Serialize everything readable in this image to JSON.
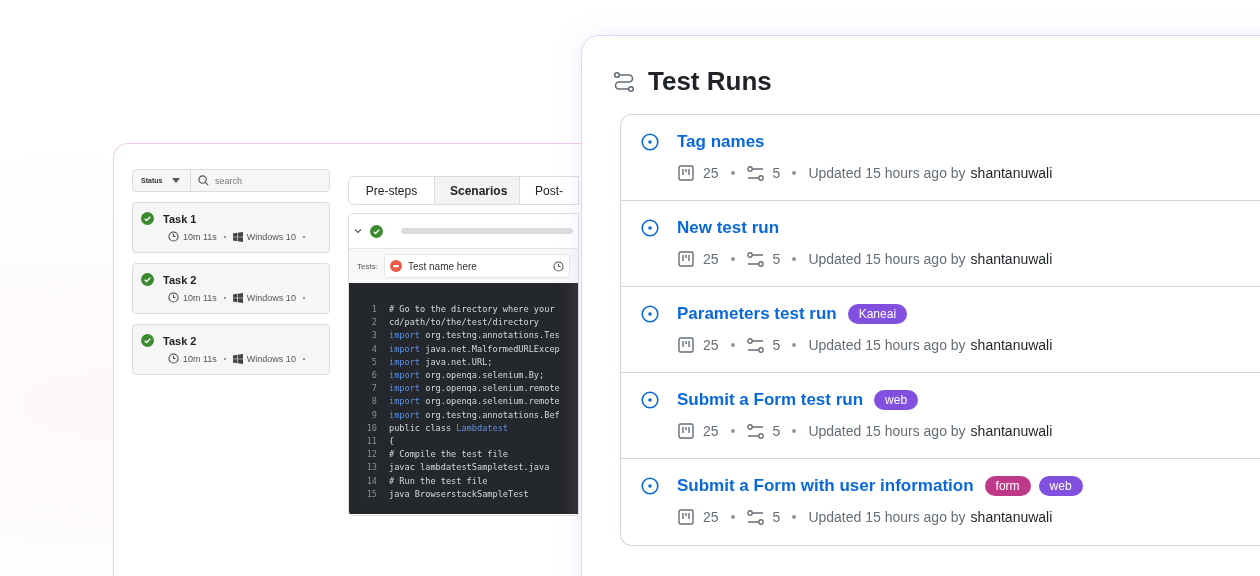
{
  "task_panel": {
    "status_filter": "Status",
    "search": {
      "placeholder": "search"
    },
    "tasks": [
      {
        "name": "Task 1",
        "passed": true,
        "duration": "10m 11s",
        "os": "Windows 10"
      },
      {
        "name": "Task 2",
        "passed": true,
        "duration": "10m 11s",
        "os": "Windows 10"
      },
      {
        "name": "Task 2",
        "passed": true,
        "duration": "10m 11s",
        "os": "Windows 10"
      }
    ]
  },
  "scenario_panel": {
    "tabs": [
      {
        "label": "Pre-steps",
        "selected": false
      },
      {
        "label": "Scenarios",
        "selected": true
      },
      {
        "label": "Post-",
        "selected": false
      }
    ],
    "scenario": {
      "passed": true,
      "expanded": true,
      "tests_label": "Tests:",
      "test_name": "Test name here"
    },
    "code": [
      {
        "number": "1",
        "parts": [
          {
            "kind": "comment",
            "text": "# Go to the directory where your"
          }
        ]
      },
      {
        "number": "2",
        "parts": [
          {
            "kind": "plain",
            "text": "cd/path/to/the/test/directory"
          }
        ]
      },
      {
        "number": "3",
        "parts": [
          {
            "kind": "keyword",
            "text": "import"
          },
          {
            "kind": "plain",
            "text": " org.testng.annotations.Tes"
          }
        ]
      },
      {
        "number": "4",
        "parts": [
          {
            "kind": "keyword",
            "text": "import"
          },
          {
            "kind": "plain",
            "text": " java.net.MalformedURLExcep"
          }
        ]
      },
      {
        "number": "5",
        "parts": [
          {
            "kind": "keyword",
            "text": "import"
          },
          {
            "kind": "plain",
            "text": " java.net.URL;"
          }
        ]
      },
      {
        "number": "6",
        "parts": [
          {
            "kind": "keyword",
            "text": "import"
          },
          {
            "kind": "plain",
            "text": " org.openqa.selenium.By;"
          }
        ]
      },
      {
        "number": "7",
        "parts": [
          {
            "kind": "keyword",
            "text": "import"
          },
          {
            "kind": "plain",
            "text": " org.openqa.selenium.remote"
          }
        ]
      },
      {
        "number": "8",
        "parts": [
          {
            "kind": "keyword",
            "text": "import"
          },
          {
            "kind": "plain",
            "text": " org.openqa.selenium.remote"
          }
        ]
      },
      {
        "number": "9",
        "parts": [
          {
            "kind": "keyword",
            "text": "import"
          },
          {
            "kind": "plain",
            "text": " org.testng.annotations.Bef"
          }
        ]
      },
      {
        "number": "10",
        "parts": [
          {
            "kind": "plain",
            "text": "public class "
          },
          {
            "kind": "keyword",
            "text": "Lambdatest"
          }
        ]
      },
      {
        "number": "11",
        "parts": [
          {
            "kind": "plain",
            "text": "{"
          }
        ]
      },
      {
        "number": "12",
        "parts": [
          {
            "kind": "comment",
            "text": "# Compile the test file"
          }
        ]
      },
      {
        "number": "13",
        "parts": [
          {
            "kind": "plain",
            "text": "javac lambdatestSampletest.java"
          }
        ]
      },
      {
        "number": "14",
        "parts": [
          {
            "kind": "comment",
            "text": "# Run the test file"
          }
        ]
      },
      {
        "number": "15",
        "parts": [
          {
            "kind": "plain",
            "text": "java BrowserstackSampleTest"
          }
        ]
      }
    ]
  },
  "test_runs": {
    "title": "Test Runs",
    "runs": [
      {
        "name": "Tag names",
        "cases": "25",
        "steps": "5",
        "updated": "Updated 15 hours ago by",
        "author": "shantanuwali"
      },
      {
        "name": "New test run",
        "cases": "25",
        "steps": "5",
        "updated": "Updated 15 hours ago by",
        "author": "shantanuwali"
      },
      {
        "name": "Parameters test run",
        "tags": [
          {
            "label": "Kaneai",
            "color": "#8250df"
          }
        ],
        "cases": "25",
        "steps": "5",
        "updated": "Updated 15 hours ago by",
        "author": "shantanuwali"
      },
      {
        "name": "Submit a Form test run",
        "tags": [
          {
            "label": "web",
            "color": "#8250df"
          }
        ],
        "cases": "25",
        "steps": "5",
        "updated": "Updated 15 hours ago by",
        "author": "shantanuwali"
      },
      {
        "name": "Submit a Form with user information",
        "tags": [
          {
            "label": "form",
            "color": "#bf3989"
          },
          {
            "label": "web",
            "color": "#8250df"
          }
        ],
        "cases": "25",
        "steps": "5",
        "updated": "Updated 15 hours ago by",
        "author": "shantanuwali"
      }
    ]
  }
}
